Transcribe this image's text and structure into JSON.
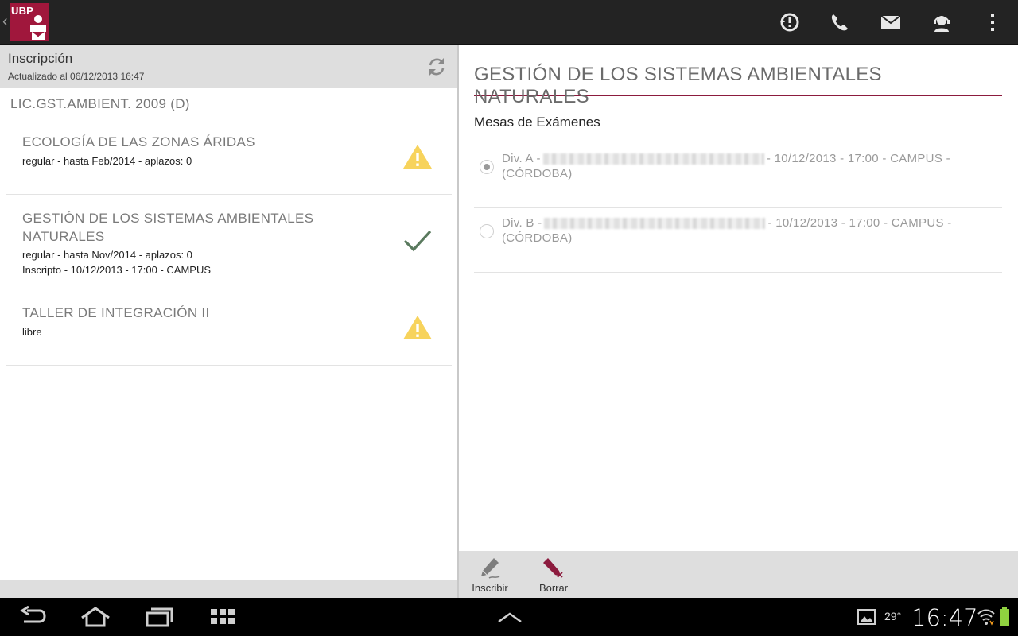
{
  "app": {
    "logo_text": "UBP",
    "colors": {
      "brand": "#a0173c",
      "accent_line": "#8c1b3e",
      "warning": "#f7d35c",
      "check": "#5a7a5e"
    }
  },
  "actionbar_icons": [
    "alert-clock-icon",
    "phone-icon",
    "mail-icon",
    "support-agent-icon",
    "overflow-menu-icon"
  ],
  "left": {
    "title": "Inscripción",
    "subtitle": "Actualizado al 06/12/2013 16:47",
    "career": "LIC.GST.AMBIENT. 2009 (D)",
    "subjects": [
      {
        "name": "ECOLOGÍA DE LAS ZONAS ÁRIDAS",
        "line1": "regular - hasta Feb/2014 - aplazos: 0",
        "line2": "",
        "status_icon": "warning-icon"
      },
      {
        "name": "GESTIÓN DE LOS SISTEMAS AMBIENTALES NATURALES",
        "line1": "regular - hasta Nov/2014 - aplazos: 0",
        "line2": "Inscripto - 10/12/2013 - 17:00 - CAMPUS",
        "status_icon": "check-icon"
      },
      {
        "name": "TALLER DE INTEGRACIÓN II",
        "line1": "libre",
        "line2": "",
        "status_icon": "warning-icon"
      }
    ]
  },
  "right": {
    "title": "GESTIÓN DE LOS SISTEMAS AMBIENTALES NATURALES",
    "section": "Mesas de Exámenes",
    "mesas": [
      {
        "prefix": "Div. A -",
        "suffix": "- 10/12/2013 - 17:00 - CAMPUS - (CÓRDOBA)",
        "selected": true
      },
      {
        "prefix": "Div. B -",
        "suffix": "- 10/12/2013 - 17:00 - CAMPUS - (CÓRDOBA)",
        "selected": false
      }
    ],
    "toolbar": {
      "inscribir": "Inscribir",
      "borrar": "Borrar"
    }
  },
  "status_bar": {
    "temperature": "29°",
    "time": "16:47"
  }
}
